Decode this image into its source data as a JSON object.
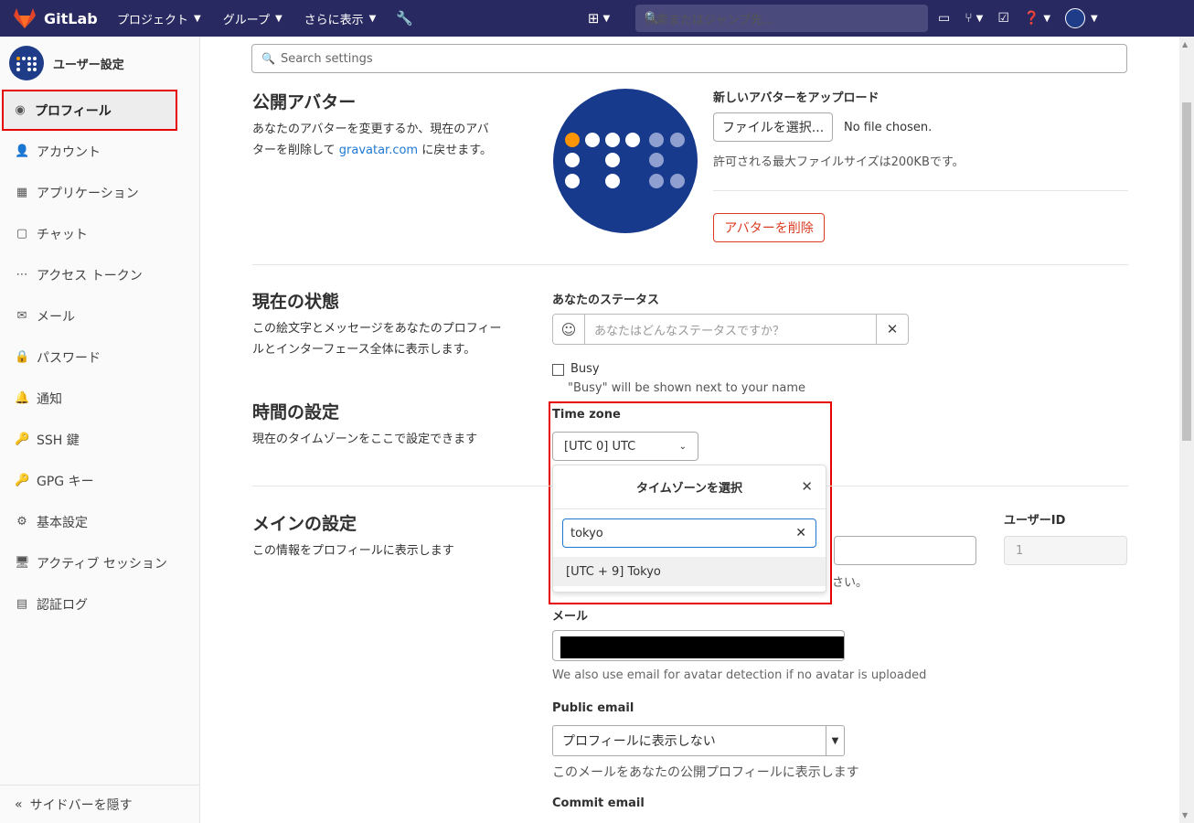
{
  "navbar": {
    "brand": "GitLab",
    "items": [
      {
        "label": "プロジェクト"
      },
      {
        "label": "グループ"
      },
      {
        "label": "さらに表示"
      }
    ],
    "search_placeholder": "検索またはジャンプ先..."
  },
  "sidebar": {
    "title": "ユーザー設定",
    "items": [
      {
        "label": "プロフィール",
        "icon": "profile-icon"
      },
      {
        "label": "アカウント",
        "icon": "account-icon"
      },
      {
        "label": "アプリケーション",
        "icon": "applications-icon"
      },
      {
        "label": "チャット",
        "icon": "chat-icon"
      },
      {
        "label": "アクセス トークン",
        "icon": "token-icon"
      },
      {
        "label": "メール",
        "icon": "mail-icon"
      },
      {
        "label": "パスワード",
        "icon": "lock-icon"
      },
      {
        "label": "通知",
        "icon": "bell-icon"
      },
      {
        "label": "SSH 鍵",
        "icon": "key-icon"
      },
      {
        "label": "GPG キー",
        "icon": "key-icon"
      },
      {
        "label": "基本設定",
        "icon": "preferences-icon"
      },
      {
        "label": "アクティブ セッション",
        "icon": "monitor-icon"
      },
      {
        "label": "認証ログ",
        "icon": "log-icon"
      }
    ],
    "collapse_label": "サイドバーを隠す"
  },
  "main": {
    "search_placeholder": "Search settings",
    "avatar_section": {
      "title": "公開アバター",
      "desc_1": "あなたのアバターを変更するか、現在のアバ",
      "desc_2": "ターを削除して",
      "desc_link": "gravatar.com",
      "desc_3": "に戻せます。",
      "upload_label": "新しいアバターをアップロード",
      "choose_file": "ファイルを選択...",
      "no_file": "No file chosen.",
      "max_size": "許可される最大ファイルサイズは200KBです。",
      "remove": "アバターを削除"
    },
    "status_section": {
      "title": "現在の状態",
      "desc_1": "この絵文字とメッセージをあなたのプロフィー",
      "desc_2": "ルとインターフェース全体に表示します。",
      "your_status": "あなたのステータス",
      "status_placeholder": "あなたはどんなステータスですか？",
      "busy": "Busy",
      "busy_hint": "\"Busy\" will be shown next to your name"
    },
    "time_section": {
      "title": "時間の設定",
      "desc": "現在のタイムゾーンをここで設定できます",
      "tz_label": "Time zone",
      "tz_value": "[UTC 0] UTC",
      "dropdown_title": "タイムゾーンを選択",
      "search_value": "tokyo",
      "result": "[UTC + 9] Tokyo"
    },
    "main_section": {
      "title": "メインの設定",
      "desc": "この情報をプロフィールに表示します",
      "user_id_label": "ユーザーID",
      "user_id_value": "1",
      "partial_hint": "さい。",
      "email_label": "メール",
      "email_hint": "We also use email for avatar detection if no avatar is uploaded",
      "public_email_label": "Public email",
      "public_email_value": "プロフィールに表示しない",
      "public_email_hint": "このメールをあなたの公開プロフィールに表示します",
      "commit_email_label": "Commit email"
    }
  }
}
